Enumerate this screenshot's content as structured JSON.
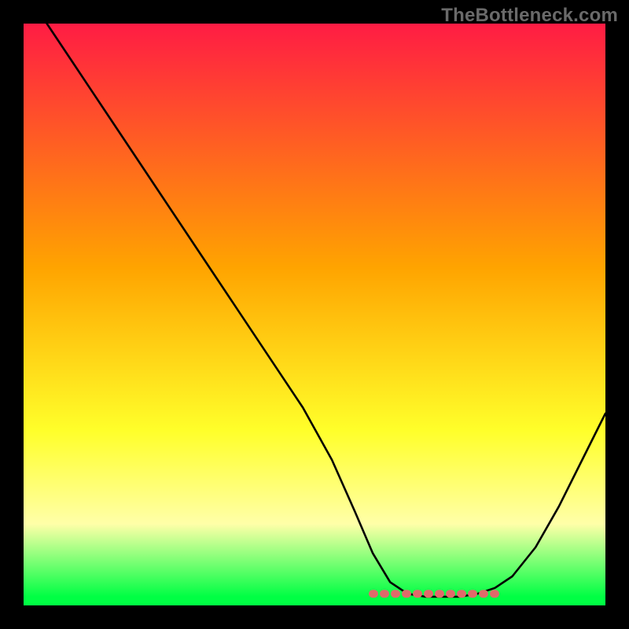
{
  "watermark": "TheBottleneck.com",
  "colors": {
    "black": "#000000",
    "topRed": "#ff1c44",
    "orange": "#ffa400",
    "yellow": "#ffff2a",
    "paleYellow": "#ffffa8",
    "green": "#00ff44",
    "curveBlack": "#000000",
    "dotPink": "#e06a6a"
  },
  "chart_data": {
    "type": "line",
    "title": "",
    "xlabel": "",
    "ylabel": "",
    "xlim": [
      0,
      100
    ],
    "ylim": [
      0,
      100
    ],
    "series": [
      {
        "name": "bottleneck-curve",
        "x": [
          4,
          8,
          12,
          18,
          24,
          30,
          36,
          42,
          48,
          53,
          57,
          60,
          63,
          66,
          69,
          72,
          75,
          78,
          81,
          84,
          88,
          92,
          96,
          100
        ],
        "y": [
          100,
          94,
          88,
          79,
          70,
          61,
          52,
          43,
          34,
          25,
          16,
          9,
          4,
          2,
          1.5,
          1.5,
          1.5,
          2,
          3,
          5,
          10,
          17,
          25,
          33
        ]
      }
    ],
    "highlight_band": {
      "name": "optimal-region",
      "x_start": 60,
      "x_end": 82,
      "y": 2,
      "color": "#e06a6a"
    },
    "background_gradient_stops": [
      {
        "pos": 0.0,
        "color": "#ff1c44"
      },
      {
        "pos": 0.42,
        "color": "#ffa400"
      },
      {
        "pos": 0.7,
        "color": "#ffff2a"
      },
      {
        "pos": 0.86,
        "color": "#ffffa8"
      },
      {
        "pos": 0.985,
        "color": "#00ff44"
      }
    ]
  }
}
